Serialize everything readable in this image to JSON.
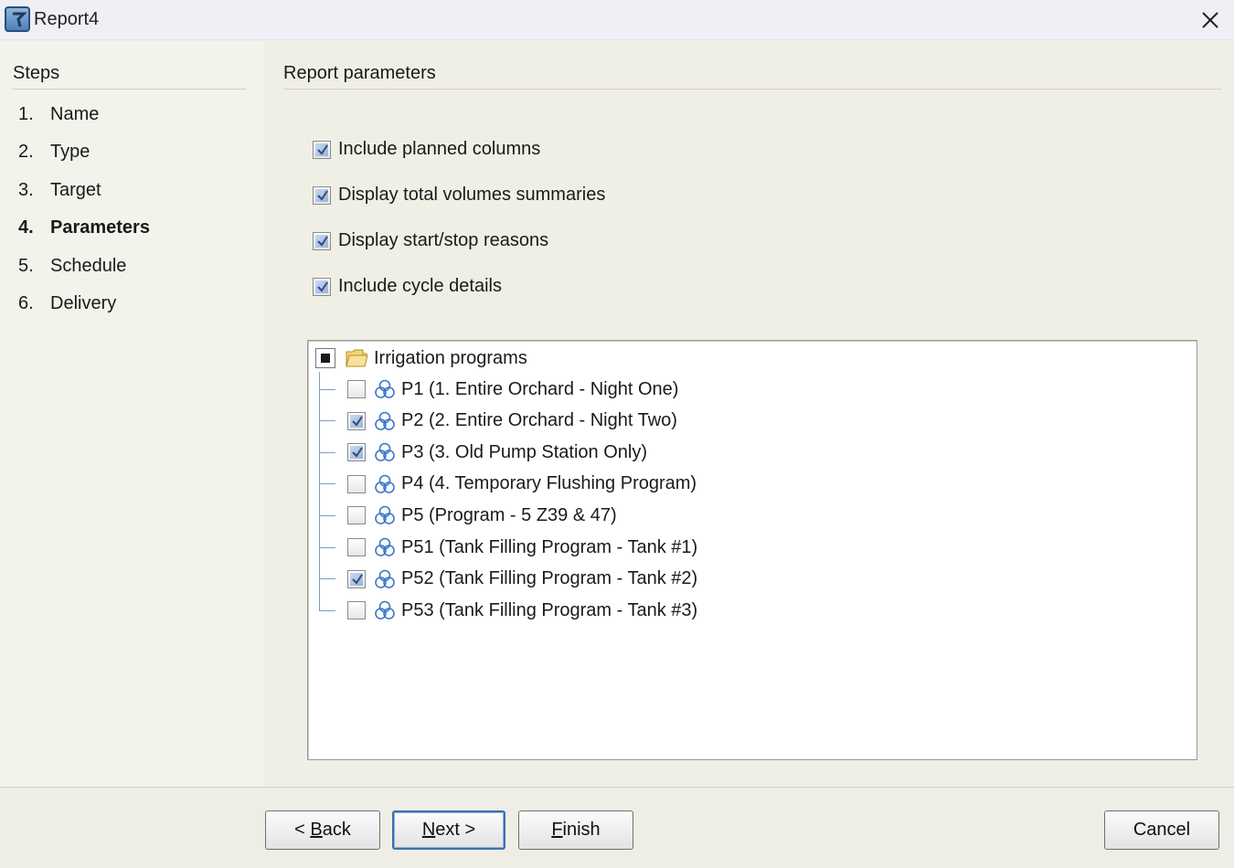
{
  "window": {
    "title": "Report4"
  },
  "steps": {
    "header": "Steps",
    "items": [
      {
        "num": "1.",
        "label": "Name"
      },
      {
        "num": "2.",
        "label": "Type"
      },
      {
        "num": "3.",
        "label": "Target"
      },
      {
        "num": "4.",
        "label": "Parameters"
      },
      {
        "num": "5.",
        "label": "Schedule"
      },
      {
        "num": "6.",
        "label": "Delivery"
      }
    ],
    "active_index": 3
  },
  "main": {
    "header": "Report parameters",
    "options": [
      {
        "label": "Include planned columns",
        "checked": true
      },
      {
        "label": "Display total volumes summaries",
        "checked": true
      },
      {
        "label": "Display start/stop reasons",
        "checked": true
      },
      {
        "label": "Include cycle details",
        "checked": true
      }
    ],
    "tree": {
      "root_label": "Irrigation programs",
      "root_state": "partial",
      "items": [
        {
          "label": "P1 (1. Entire Orchard - Night One)",
          "checked": false
        },
        {
          "label": "P2 (2. Entire Orchard - Night Two)",
          "checked": true
        },
        {
          "label": "P3 (3. Old Pump Station Only)",
          "checked": true
        },
        {
          "label": "P4 (4. Temporary Flushing Program)",
          "checked": false
        },
        {
          "label": "P5 (Program - 5 Z39 & 47)",
          "checked": false
        },
        {
          "label": "P51 (Tank Filling Program - Tank #1)",
          "checked": false
        },
        {
          "label": "P52 (Tank Filling Program - Tank #2)",
          "checked": true
        },
        {
          "label": "P53 (Tank Filling Program - Tank #3)",
          "checked": false
        }
      ]
    }
  },
  "footer": {
    "back": {
      "prefix": "< ",
      "mnemonic": "B",
      "rest": "ack"
    },
    "next": {
      "mnemonic": "N",
      "rest": "ext >"
    },
    "finish": {
      "mnemonic": "F",
      "rest": "inish"
    },
    "cancel": "Cancel"
  },
  "icons": {
    "app": "report-app-icon",
    "close": "close-icon",
    "folder": "folder-icon",
    "program": "irrigation-program-icon",
    "check": "checkmark-icon"
  },
  "colors": {
    "accent": "#3d6fb0",
    "tree_line": "#7a9ccc",
    "program_icon": "#3a78c9",
    "folder": "#e9c15a"
  }
}
